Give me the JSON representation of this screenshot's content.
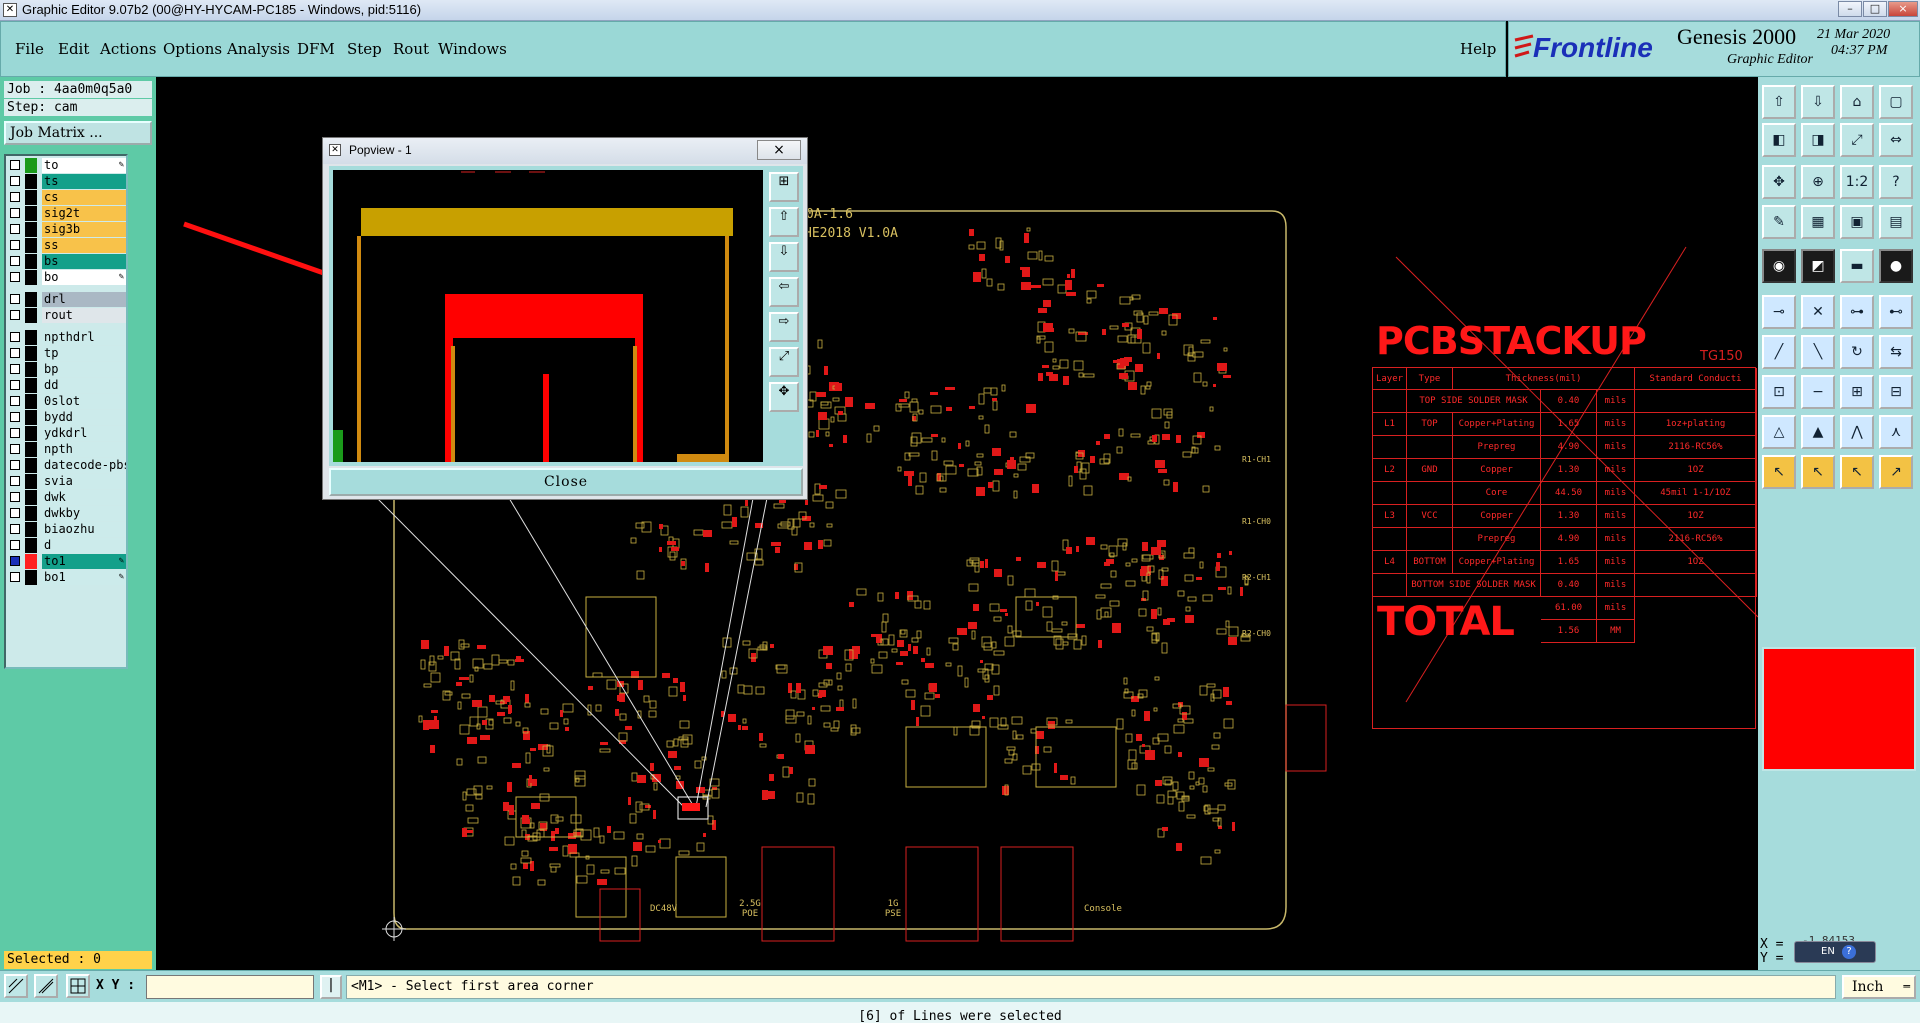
{
  "window": {
    "title": "Graphic Editor 9.07b2 (00@HY-HYCAM-PC185 - Windows, pid:5116)",
    "controls": [
      "–",
      "□",
      "×"
    ]
  },
  "menu": {
    "items": [
      "File",
      "Edit",
      "Actions",
      "Options",
      "Analysis",
      "DFM",
      "Step",
      "Rout",
      "Windows"
    ],
    "help": "Help"
  },
  "brand": {
    "logo": "Frontline",
    "product": "Genesis 2000",
    "subtitle": "Graphic Editor",
    "date": "21 Mar 2020",
    "time": "04:37 PM"
  },
  "job": {
    "job_line": "Job : 4aa0m0q5a0",
    "step_line": "Step: cam",
    "matrix_button": "Job Matrix ..."
  },
  "layers": [
    {
      "name": "to",
      "color": "#ffffff",
      "swatch": "#1a9a1a",
      "pen": true
    },
    {
      "name": "ts",
      "color": "#13a08a",
      "swatch": "#000000",
      "pen": false
    },
    {
      "name": "cs",
      "color": "#f8c24a",
      "swatch": "#000000",
      "pen": false
    },
    {
      "name": "sig2t",
      "color": "#f8c24a",
      "swatch": "#000000",
      "pen": false
    },
    {
      "name": "sig3b",
      "color": "#f8c24a",
      "swatch": "#000000",
      "pen": false
    },
    {
      "name": "ss",
      "color": "#f8c24a",
      "swatch": "#000000",
      "pen": false
    },
    {
      "name": "bs",
      "color": "#13a08a",
      "swatch": "#000000",
      "pen": false
    },
    {
      "name": "bo",
      "color": "#ffffff",
      "swatch": "#000000",
      "pen": true
    },
    {
      "name": "drl",
      "color": "#aab8c4",
      "swatch": "#000000",
      "pen": false
    },
    {
      "name": "rout",
      "color": "#dfe6ea",
      "swatch": "#000000",
      "pen": false
    },
    {
      "name": "npthdrl",
      "color": "#ccebeb",
      "swatch": "#000000",
      "pen": false
    },
    {
      "name": "tp",
      "color": "#ccebeb",
      "swatch": "#000000",
      "pen": false
    },
    {
      "name": "bp",
      "color": "#ccebeb",
      "swatch": "#000000",
      "pen": false
    },
    {
      "name": "dd",
      "color": "#ccebeb",
      "swatch": "#000000",
      "pen": false
    },
    {
      "name": "0slot",
      "color": "#ccebeb",
      "swatch": "#000000",
      "pen": false
    },
    {
      "name": "bydd",
      "color": "#ccebeb",
      "swatch": "#000000",
      "pen": false
    },
    {
      "name": "ydkdrl",
      "color": "#ccebeb",
      "swatch": "#000000",
      "pen": false
    },
    {
      "name": "npth",
      "color": "#ccebeb",
      "swatch": "#000000",
      "pen": false
    },
    {
      "name": "datecode-pbs",
      "color": "#ccebeb",
      "swatch": "#000000",
      "pen": false
    },
    {
      "name": "svia",
      "color": "#ccebeb",
      "swatch": "#000000",
      "pen": false
    },
    {
      "name": "dwk",
      "color": "#ccebeb",
      "swatch": "#000000",
      "pen": false
    },
    {
      "name": "dwkby",
      "color": "#ccebeb",
      "swatch": "#000000",
      "pen": false
    },
    {
      "name": "biaozhu",
      "color": "#ccebeb",
      "swatch": "#000000",
      "pen": false
    },
    {
      "name": "d",
      "color": "#ccebeb",
      "swatch": "#000000",
      "pen": false
    },
    {
      "name": "to1",
      "color": "#13a08a",
      "swatch": "#ff2020",
      "pen": true,
      "checked": true
    },
    {
      "name": "bo1",
      "color": "#ccebeb",
      "swatch": "#000000",
      "pen": true
    }
  ],
  "selected_text": "Selected : 0",
  "popview": {
    "title": "Popview - 1",
    "close_x": "×",
    "close_button": "Close"
  },
  "board": {
    "text_top1": "0A-1.6",
    "text_top2": "HE2018 V1.0A",
    "labels": [
      "DC48V",
      "2.5G POE",
      "1G PSE",
      "Console",
      "R1-CH1",
      "R1-CH0",
      "R2-CH1",
      "R2-CH0"
    ]
  },
  "stackup": {
    "title": "PCBSTACKUP",
    "tg": "TG150",
    "headers": [
      "Layer",
      "Type",
      "Thickness(mil)",
      "Standard Conducti"
    ],
    "rows": [
      [
        "",
        "TOP SIDE SOLDER MASK",
        "",
        "0.40",
        "mils",
        ""
      ],
      [
        "L1",
        "TOP",
        "Copper+Plating",
        "1.65",
        "mils",
        "1oz+plating"
      ],
      [
        "",
        "",
        "Prepreg",
        "4.90",
        "mils",
        "2116-RC56%"
      ],
      [
        "L2",
        "GND",
        "Copper",
        "1.30",
        "mils",
        "1OZ"
      ],
      [
        "",
        "",
        "Core",
        "44.50",
        "mils",
        "45mil 1-1/1OZ"
      ],
      [
        "L3",
        "VCC",
        "Copper",
        "1.30",
        "mils",
        "1OZ"
      ],
      [
        "",
        "",
        "Prepreg",
        "4.90",
        "mils",
        "2116-RC56%"
      ],
      [
        "L4",
        "BOTTOM",
        "Copper+Plating",
        "1.65",
        "mils",
        "1OZ"
      ],
      [
        "",
        "BOTTOM SIDE SOLDER MASK",
        "",
        "0.40",
        "mils",
        ""
      ]
    ],
    "total_label": "TOTAL",
    "total_mils": "61.00",
    "total_mils_unit": "mils",
    "total_mm": "1.56",
    "total_mm_unit": "MM"
  },
  "toolbox": {
    "buttons": [
      "step-in",
      "step-out",
      "home",
      "window",
      "prev",
      "next",
      "fit",
      "expand",
      "fit-all",
      "zoom",
      "ratio",
      "help",
      "measure",
      "grid",
      "layer-a",
      "layer-b",
      "snap",
      "draw",
      "ruler",
      "dot",
      "add-pad",
      "x-tool",
      "line-pad",
      "arc-pad",
      "line-a",
      "line-b",
      "rotate",
      "flip",
      "pad-a",
      "minus",
      "move",
      "pattern",
      "tri-a",
      "tri-b",
      "tri-c",
      "tri-d",
      "sel-a",
      "sel-b",
      "sel-c",
      "sel-d"
    ],
    "xy_x": "X =",
    "xy_y": "Y =",
    "xy_value": "-1.84153",
    "ime": "EN"
  },
  "bottom": {
    "xy_label": "X Y :",
    "xy_value": "",
    "prompt": "<M1> - Select first area corner",
    "units": "Inch"
  },
  "status": {
    "message": "[6] of Lines were selected"
  }
}
